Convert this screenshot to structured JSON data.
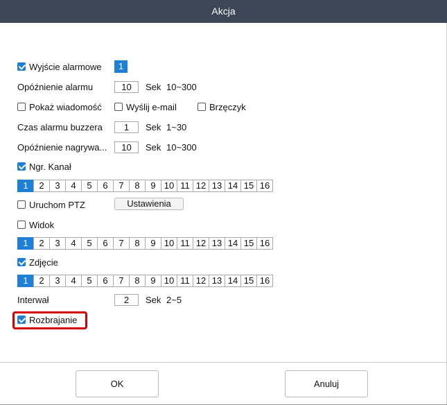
{
  "window": {
    "title": "Akcja"
  },
  "alarm_output": {
    "label": "Wyjście alarmowe",
    "checked": true,
    "value": "1"
  },
  "alarm_delay": {
    "label": "Opóźnienie alarmu",
    "value": "10",
    "unit": "Sek",
    "range": "10~300"
  },
  "options": {
    "show_message": {
      "label": "Pokaż wiadomość",
      "checked": false
    },
    "send_email": {
      "label": "Wyślij e-mail",
      "checked": false
    },
    "buzzer": {
      "label": "Brzęczyk",
      "checked": false
    }
  },
  "buzzer_time": {
    "label": "Czas alarmu buzzera",
    "value": "1",
    "unit": "Sek",
    "range": "1~30"
  },
  "record_delay": {
    "label": "Opóźnienie nagrywa...",
    "value": "10",
    "unit": "Sek",
    "range": "10~300"
  },
  "record_channel": {
    "label": "Ngr. Kanał",
    "checked": true,
    "selected": 1
  },
  "ptz": {
    "label": "Uruchom PTZ",
    "checked": false,
    "settings_label": "Ustawienia"
  },
  "view": {
    "label": "Widok",
    "checked": false,
    "selected": 1
  },
  "snapshot": {
    "label": "Zdjęcie",
    "checked": true,
    "selected": 1
  },
  "interval": {
    "label": "Interwał",
    "value": "2",
    "unit": "Sek",
    "range": "2~5"
  },
  "disarm": {
    "label": "Rozbrajanie",
    "checked": true
  },
  "channels": [
    "1",
    "2",
    "3",
    "4",
    "5",
    "6",
    "7",
    "8",
    "9",
    "10",
    "11",
    "12",
    "13",
    "14",
    "15",
    "16"
  ],
  "buttons": {
    "ok": "OK",
    "cancel": "Anuluj"
  },
  "colors": {
    "accent": "#1e7fd6",
    "titlebar": "#3b4656",
    "highlight": "#d40000"
  }
}
